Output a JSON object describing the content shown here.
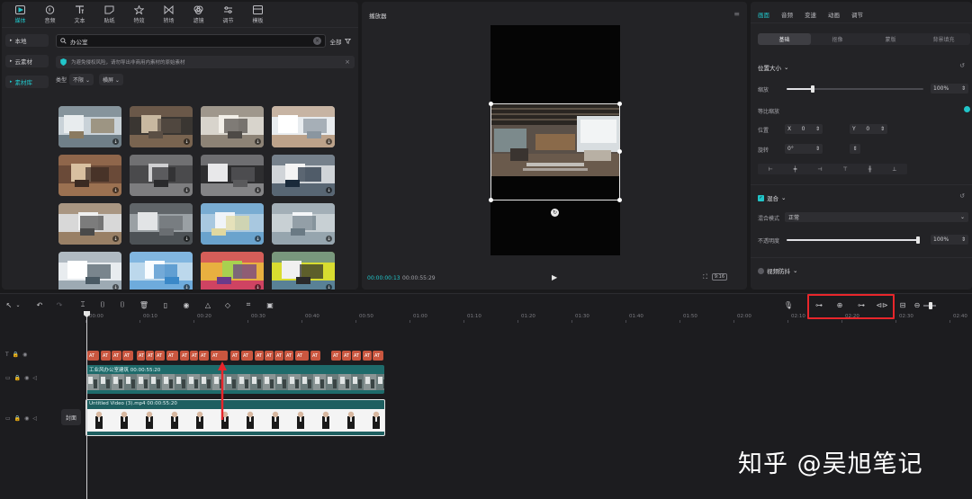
{
  "media_tabs": [
    {
      "label": "媒体",
      "icon": "media-icon",
      "active": true
    },
    {
      "label": "音频",
      "icon": "audio-icon"
    },
    {
      "label": "文本",
      "icon": "text-icon"
    },
    {
      "label": "贴纸",
      "icon": "sticker-icon"
    },
    {
      "label": "特效",
      "icon": "effects-icon"
    },
    {
      "label": "转场",
      "icon": "transition-icon"
    },
    {
      "label": "滤镜",
      "icon": "filter-icon"
    },
    {
      "label": "调节",
      "icon": "adjust-icon"
    },
    {
      "label": "模板",
      "icon": "template-icon"
    }
  ],
  "media_side": [
    {
      "label": "本地"
    },
    {
      "label": "云素材"
    },
    {
      "label": "素材库",
      "active": true
    }
  ],
  "search": {
    "value": "办公室",
    "filter_label": "全部"
  },
  "notice": {
    "text": "为避免侵权风险，请勿导出非商用内素材的原始素材"
  },
  "filters": {
    "type_label": "类型",
    "type_value": "不限",
    "orient_value": "横屏"
  },
  "preview": {
    "title": "播放器",
    "time_current": "00:00:00:13",
    "time_total": "00:00:55:29",
    "ratio_label": "9:16"
  },
  "props": {
    "tabs": [
      "画面",
      "音频",
      "变速",
      "动画",
      "调节"
    ],
    "sub_tabs": [
      "基础",
      "抠像",
      "蒙版",
      "背景填充"
    ],
    "position_size": "位置大小",
    "scale_label": "缩放",
    "scale_value": "100%",
    "scale_fraction": 0.19,
    "uniform_scale": "等比缩放",
    "position_label": "位置",
    "pos_x_label": "X",
    "pos_x": "0",
    "pos_y_label": "Y",
    "pos_y": "0",
    "rotate_label": "旋转",
    "rotate_value": "0°",
    "blend_title": "混合",
    "blend_mode_label": "混合模式",
    "blend_mode_value": "正常",
    "opacity_label": "不透明度",
    "opacity_value": "100%",
    "opacity_fraction": 1.0,
    "stabilize_title": "视频防抖"
  },
  "timeline": {
    "ruler": [
      "00:00",
      "00:10",
      "00:20",
      "00:30",
      "00:40",
      "00:50",
      "01:00",
      "01:10",
      "01:20",
      "01:30",
      "01:40",
      "01:50",
      "02:00",
      "02:10",
      "02:20",
      "02:30",
      "02:40"
    ],
    "text_clip_label": "AT",
    "bg_clip_label": "工业风办公室建筑  00:00:55:20",
    "main_clip_label": "Untitled Video (3).mp4  00:00:55:20",
    "cover_label": "封面"
  },
  "watermark": "知乎 @吴旭笔记",
  "colors": {
    "accent": "#21c5c9",
    "highlight_box": "#e8262b",
    "text_clip": "#c9563f",
    "video_clip": "#1e6b6b"
  }
}
